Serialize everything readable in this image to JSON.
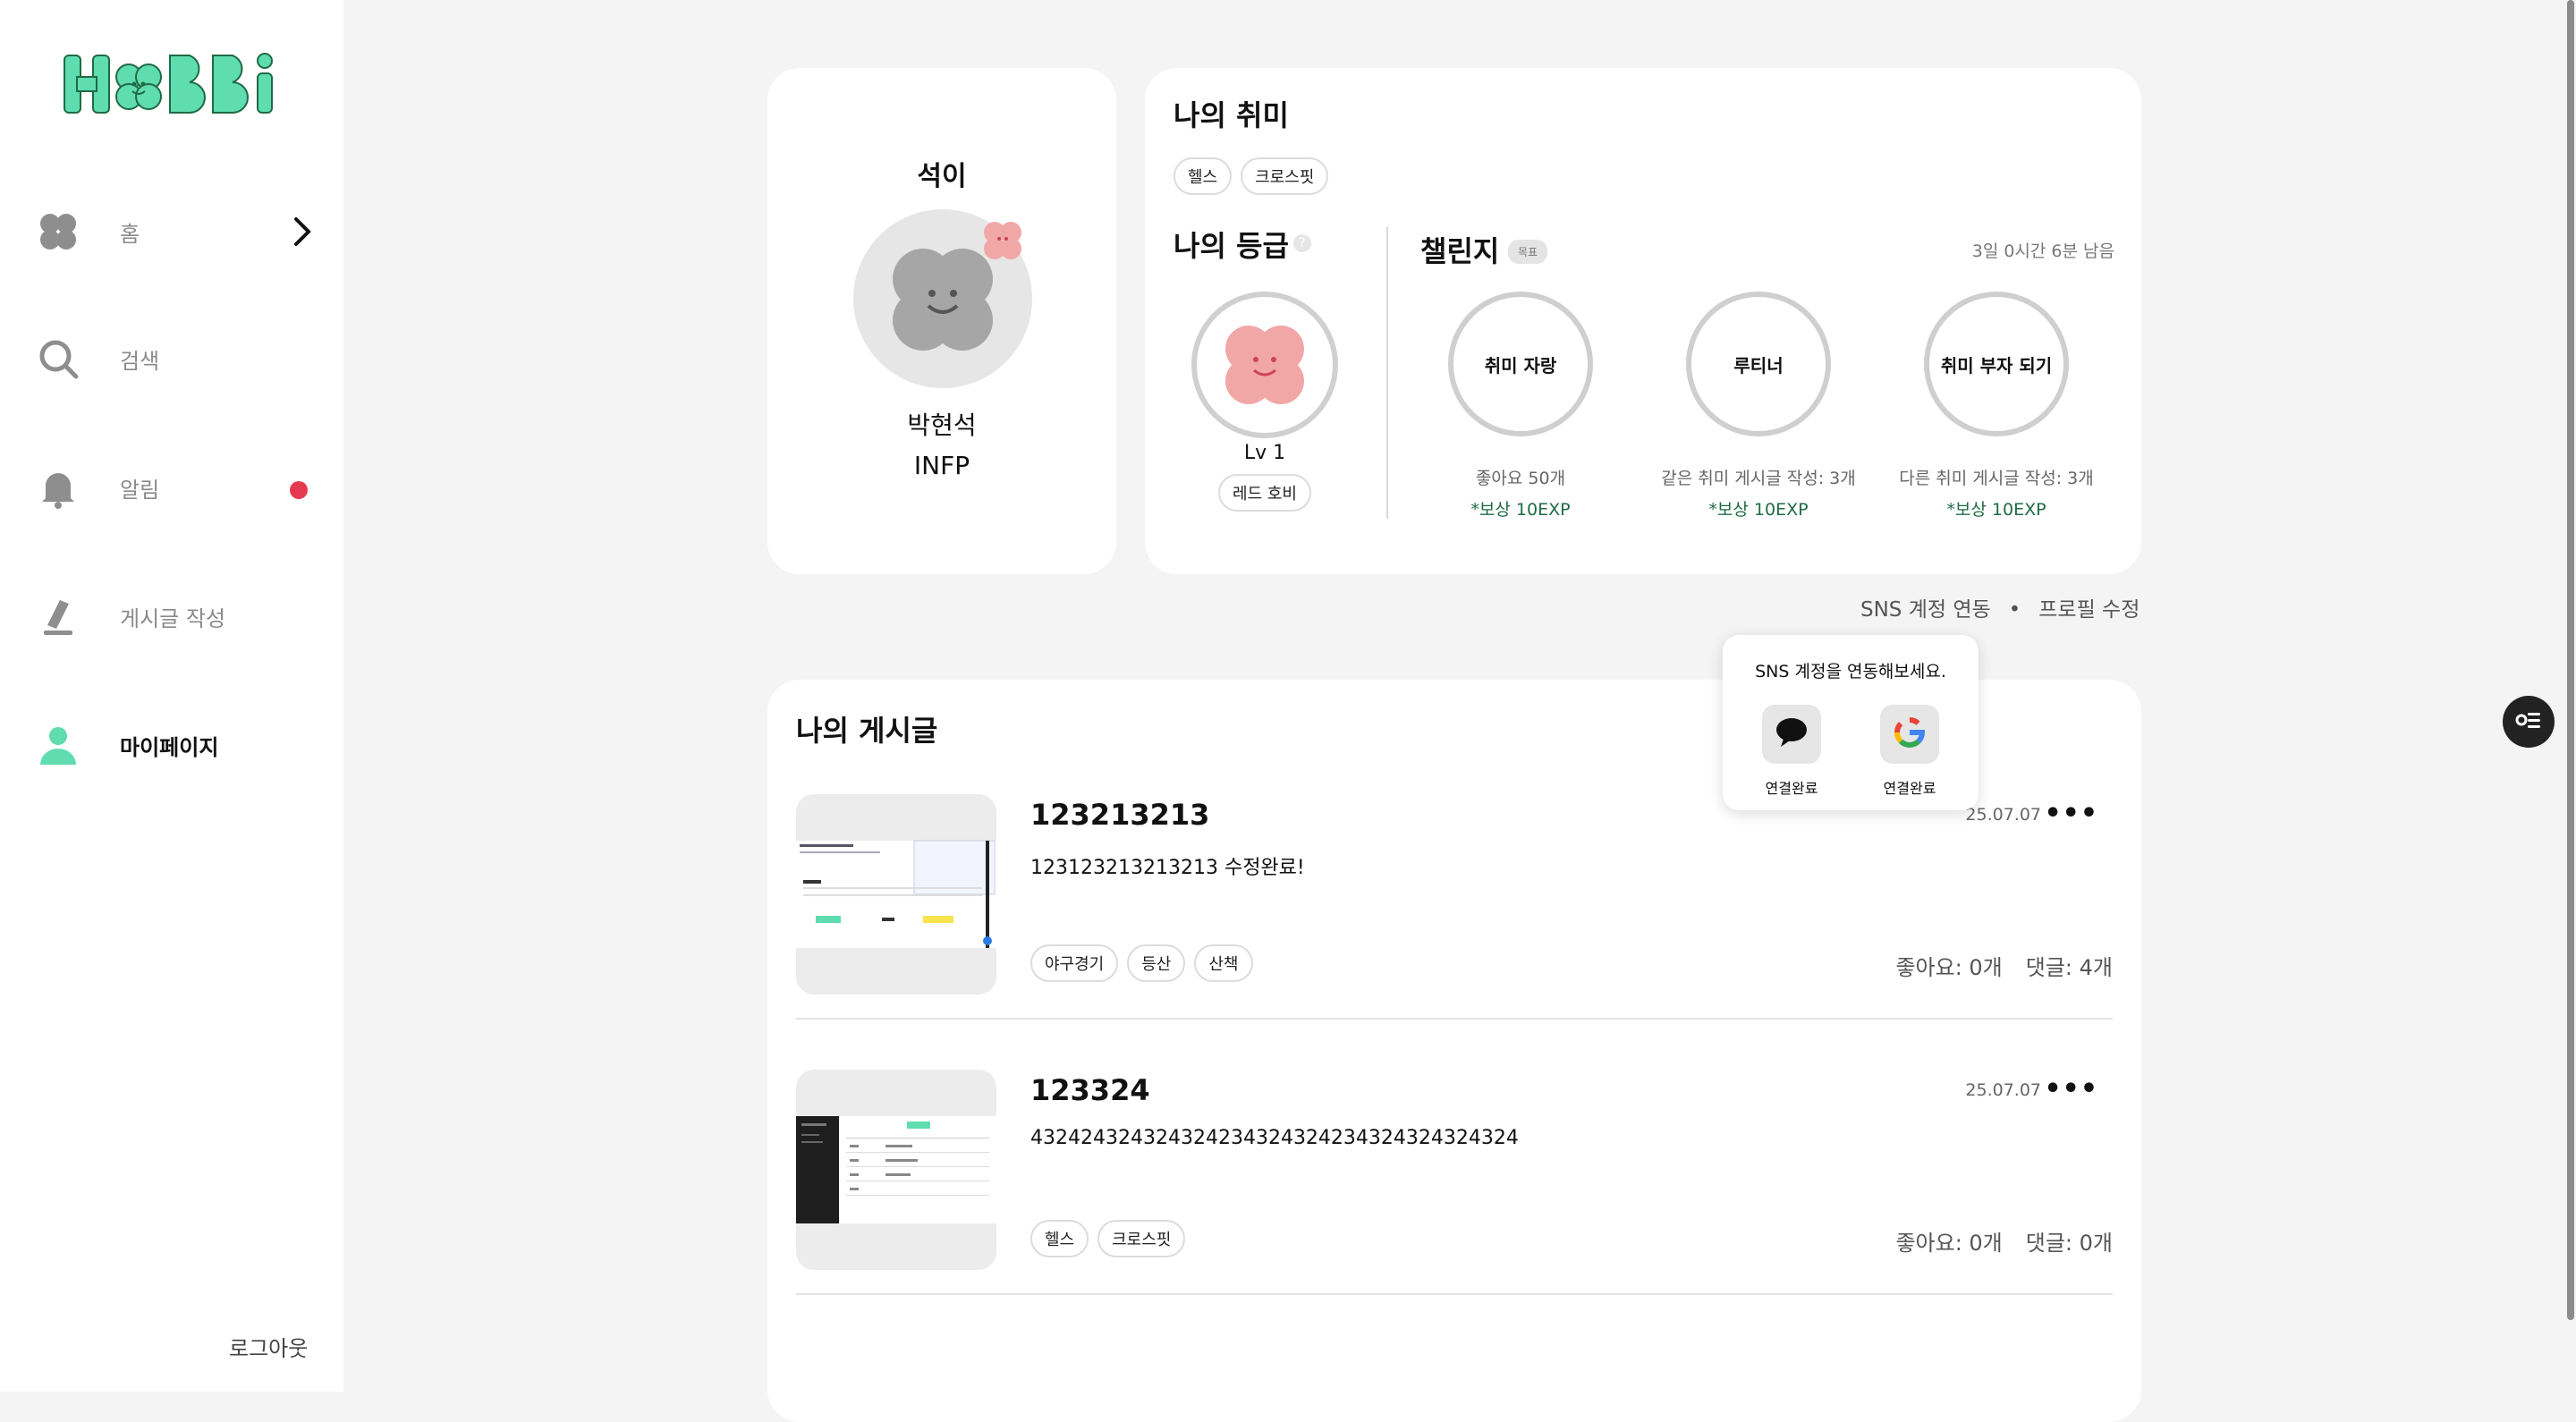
{
  "app": {
    "logo": "HOBBi",
    "brand_color": "#5fdcb0"
  },
  "sidebar": {
    "items": [
      {
        "label": "홈",
        "icon": "clover-icon"
      },
      {
        "label": "검색",
        "icon": "search-icon"
      },
      {
        "label": "알림",
        "icon": "bell-icon"
      },
      {
        "label": "게시글 작성",
        "icon": "pencil-icon"
      },
      {
        "label": "마이페이지",
        "icon": "user-icon",
        "active": true
      }
    ],
    "logout": "로그아웃"
  },
  "profile": {
    "nickname": "석이",
    "name": "박현석",
    "mbti": "INFP"
  },
  "hobbies": {
    "title": "나의 취미",
    "tags": [
      "헬스",
      "크로스핏"
    ]
  },
  "grade": {
    "title": "나의 등급",
    "level": "Lv 1",
    "name": "레드 호비"
  },
  "challenge": {
    "title": "챌린지",
    "badge": "목표",
    "time_left": "3일 0시간 6분 남음",
    "items": [
      {
        "name": "취미 자랑",
        "condition": "좋아요 50개",
        "reward": "*보상 10EXP"
      },
      {
        "name": "루티너",
        "condition": "같은 취미 게시글 작성: 3개",
        "reward": "*보상 10EXP"
      },
      {
        "name": "취미 부자 되기",
        "condition": "다른 취미 게시글 작성: 3개",
        "reward": "*보상 10EXP"
      }
    ]
  },
  "links": {
    "sns": "SNS 계정 연동",
    "separator": "•",
    "edit_profile": "프로필 수정"
  },
  "sns_popup": {
    "title": "SNS 계정을 연동해보세요.",
    "kakao_label": "연결완료",
    "google_label": "연결완료"
  },
  "posts": {
    "title": "나의 게시글",
    "items": [
      {
        "title": "123213213",
        "body": "123123213213213 수정완료!",
        "date": "25.07.07",
        "tags": [
          "야구경기",
          "등산",
          "산책"
        ],
        "likes": "좋아요: 0개",
        "comments": "댓글: 4개"
      },
      {
        "title": "123324",
        "body": "432424324324324234324324234324324324324",
        "date": "25.07.07",
        "tags": [
          "헬스",
          "크로스핏"
        ],
        "likes": "좋아요: 0개",
        "comments": "댓글: 0개"
      }
    ]
  }
}
